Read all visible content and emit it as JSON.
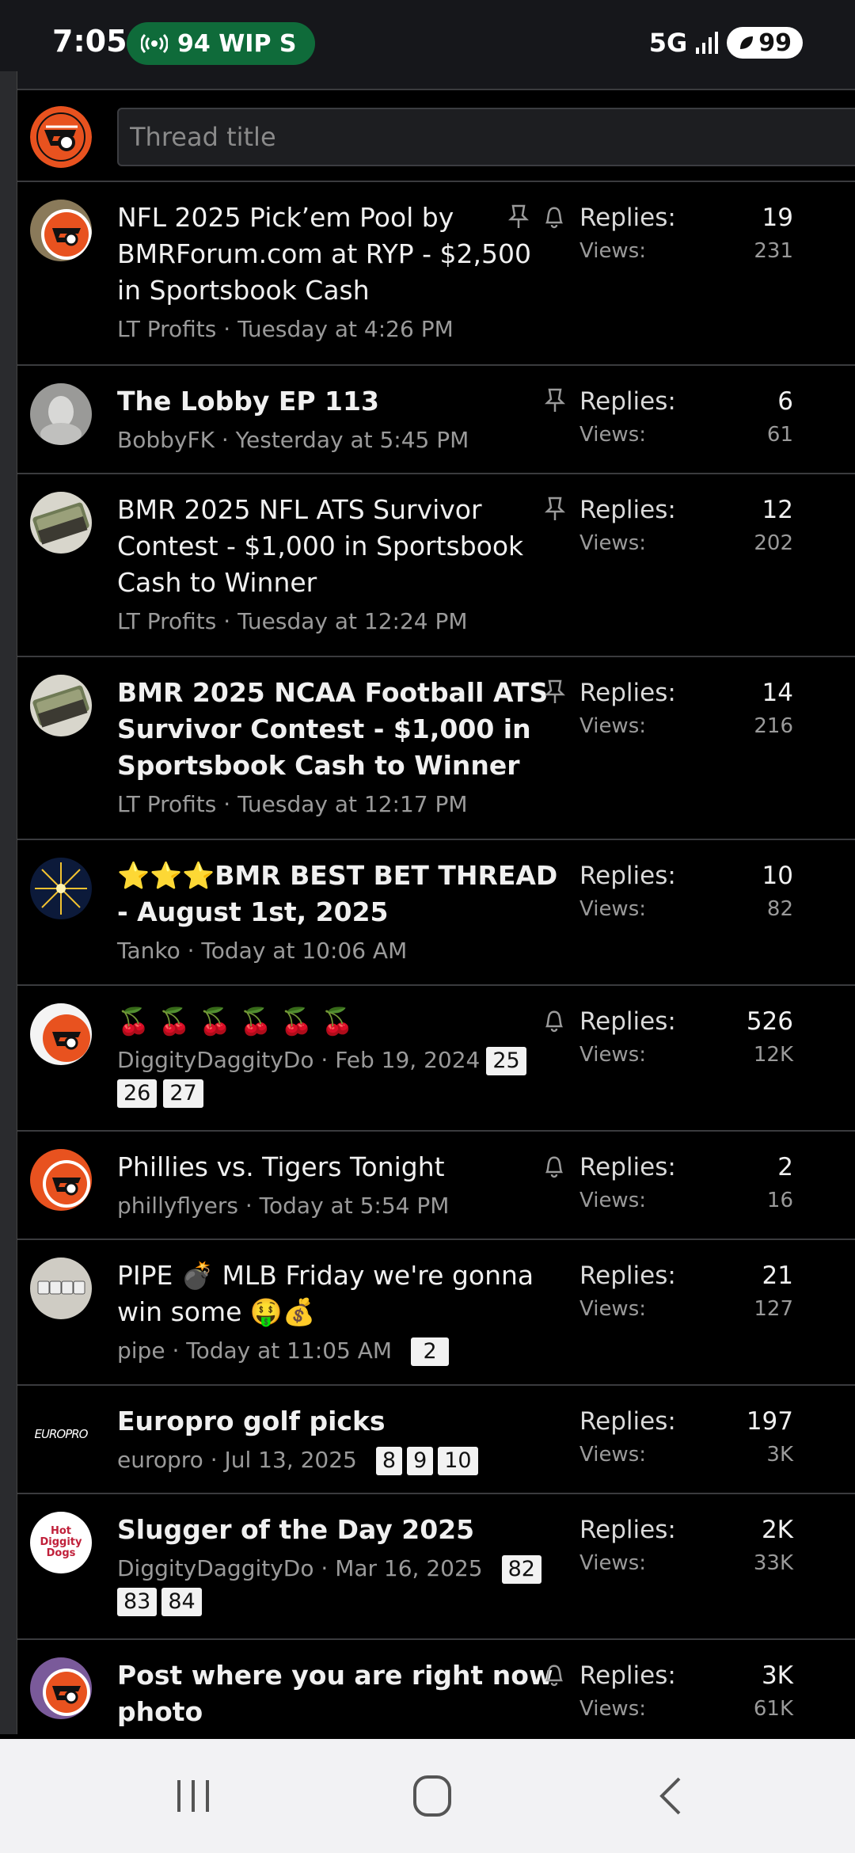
{
  "status_bar": {
    "time": "7:05",
    "pill_text": "94 WIP S",
    "network": "5G",
    "battery": "99",
    "pill_color": "#0f6b3a"
  },
  "title_input": {
    "placeholder": "Thread title"
  },
  "labels": {
    "replies": "Replies:",
    "views": "Views:"
  },
  "threads": [
    {
      "title": "NFL 2025 Pick’em Pool by BMRForum.com at RYP - $2,500 in Sportsbook Cash",
      "bold": false,
      "meta": "LT Profits · Tuesday at 4:26 PM",
      "pages": [],
      "pinned": true,
      "watched": true,
      "replies": "19",
      "views": "231",
      "avatar": "flyers-stack"
    },
    {
      "title": "The Lobby EP 113",
      "bold": true,
      "meta": "BobbyFK · Yesterday at 5:45 PM",
      "pages": [],
      "pinned": true,
      "watched": false,
      "replies": "6",
      "views": "61",
      "avatar": "grey-figure"
    },
    {
      "title": "BMR 2025 NFL ATS Survivor Contest - $1,000 in Sportsbook Cash to Winner",
      "bold": false,
      "meta": "LT Profits · Tuesday at 12:24 PM",
      "pages": [],
      "pinned": true,
      "watched": false,
      "replies": "12",
      "views": "202",
      "avatar": "cash"
    },
    {
      "title": "BMR 2025 NCAA Football ATS Survivor Contest - $1,000 in Sportsbook Cash to Winner",
      "bold": true,
      "meta": "LT Profits · Tuesday at 12:17 PM",
      "pages": [],
      "pinned": true,
      "watched": false,
      "replies": "14",
      "views": "216",
      "avatar": "cash"
    },
    {
      "title": "⭐⭐⭐BMR BEST BET THREAD - August 1st, 2025",
      "bold": true,
      "meta": "Tanko · Today at 10:06 AM",
      "pages": [],
      "pinned": false,
      "watched": false,
      "replies": "10",
      "views": "82",
      "avatar": "fireworks"
    },
    {
      "title": "🍒 🍒 🍒 🍒 🍒 🍒",
      "bold": false,
      "meta": "DiggityDaggityDo · Feb 19, 2024",
      "pages": [
        "25"
      ],
      "pages2": [
        "26",
        "27"
      ],
      "pinned": false,
      "watched": true,
      "replies": "526",
      "views": "12K",
      "avatar": "flyers-stack"
    },
    {
      "title": "Phillies vs. Tigers Tonight",
      "bold": false,
      "meta": "phillyflyers · Today at 5:54 PM",
      "pages": [],
      "pinned": false,
      "watched": true,
      "replies": "2",
      "views": "16",
      "avatar": "flyers-stack"
    },
    {
      "title": "PIPE 💣 MLB Friday we're gonna win some 🤑💰",
      "bold": false,
      "meta": "pipe · Today at 11:05 AM",
      "pages": [
        "2"
      ],
      "pinned": false,
      "watched": false,
      "replies": "21",
      "views": "127",
      "avatar": "dice"
    },
    {
      "title": "Europro golf picks",
      "bold": true,
      "meta": "europro · Jul 13, 2025",
      "pages": [
        "8",
        "9",
        "10"
      ],
      "pinned": false,
      "watched": false,
      "replies": "197",
      "views": "3K",
      "avatar": "europro",
      "avatar_text": "EUROPRO"
    },
    {
      "title": "Slugger of the Day 2025",
      "bold": true,
      "meta": "DiggityDaggityDo · Mar 16, 2025",
      "pages": [
        "82"
      ],
      "pages2": [
        "83",
        "84"
      ],
      "pinned": false,
      "watched": false,
      "replies": "2K",
      "views": "33K",
      "avatar": "hotdog",
      "avatar_text": "Hot Diggity Dogs"
    },
    {
      "title": "Post where you are right now photo",
      "bold": true,
      "meta": "",
      "pages": [],
      "pinned": false,
      "watched": true,
      "replies": "3K",
      "views": "61K",
      "avatar": "flyers-stack"
    }
  ],
  "colors": {
    "flyers_orange": "#e8521f",
    "background": "#000000",
    "divider": "#3a3b3e"
  }
}
